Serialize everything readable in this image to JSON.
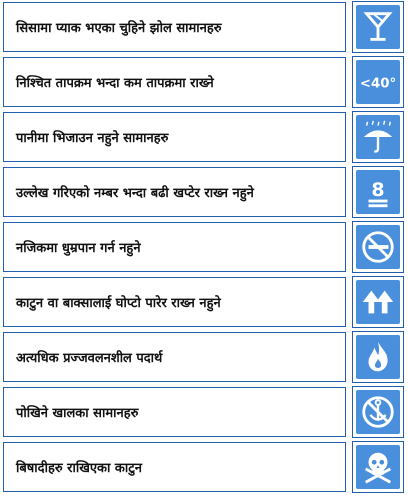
{
  "colors": {
    "border": "#1f5fae",
    "icon_bg": "#4a8fdc",
    "icon_fg": "#ffffff"
  },
  "rows": [
    {
      "label": "सिसामा प्याक भएका चुहिने झोल सामानहरु",
      "icon": "fragile-glass-icon"
    },
    {
      "label": "निश्चित तापक्रम भन्दा कम तापक्रमा राख्ने",
      "icon": "temperature-below-40-icon",
      "icon_text": "<40°"
    },
    {
      "label": "पानीमा भिजाउन नहुने सामानहरु",
      "icon": "keep-dry-umbrella-icon"
    },
    {
      "label": "उल्लेख गरिएको नम्बर भन्दा बढी खप्टेर राख्न नहुने",
      "icon": "stack-limit-8-icon",
      "icon_text": "8"
    },
    {
      "label": "नजिकमा धुम्रपान गर्न नहुने",
      "icon": "no-smoking-icon"
    },
    {
      "label": "काटुन वा बाक्सालाई घोप्टो पारेर राख्न नहुने",
      "icon": "this-way-up-arrows-icon"
    },
    {
      "label": "अत्यधिक प्रज्जवलनशील पदार्थ",
      "icon": "flammable-flame-icon"
    },
    {
      "label": "पोखिने खालका सामानहरु",
      "icon": "no-hooks-anchor-icon"
    },
    {
      "label": "बिषादीहरु राखिएका काटुन",
      "icon": "poison-skull-icon"
    }
  ]
}
